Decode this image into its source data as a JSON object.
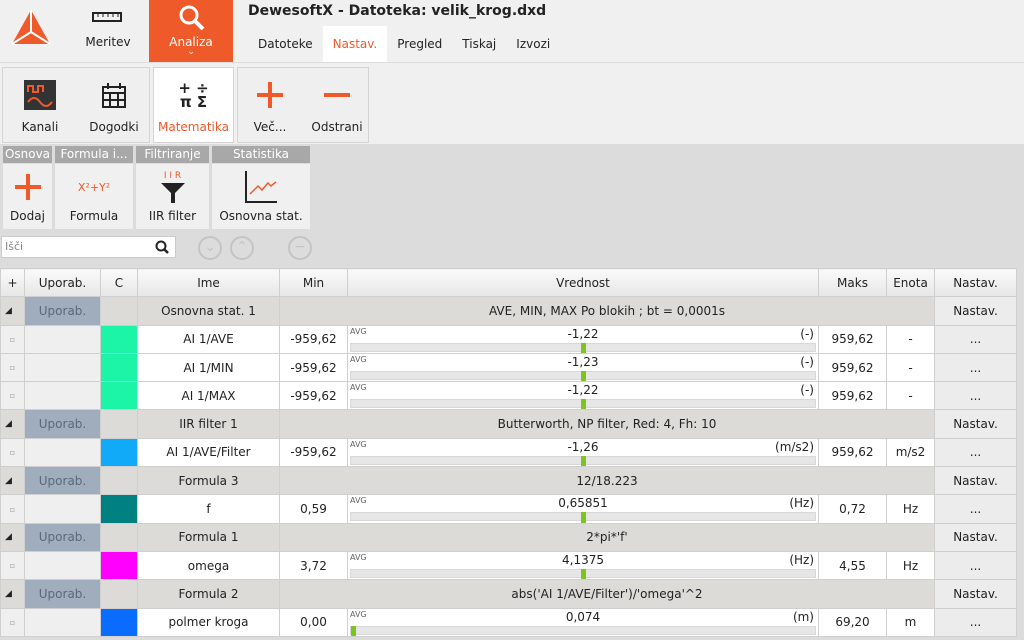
{
  "app": {
    "title": "DewesoftX - Datoteka: velik_krog.dxd",
    "modes": [
      {
        "label": "Meritev",
        "icon": "ruler-icon"
      },
      {
        "label": "Analiza",
        "icon": "search-icon",
        "active": true
      }
    ],
    "menu": [
      "Datoteke",
      "Nastav.",
      "Pregled",
      "Tiskaj",
      "Izvozi"
    ],
    "active_menu": "Nastav."
  },
  "ribbon": [
    {
      "label": "Kanali",
      "icon": "channels-icon"
    },
    {
      "label": "Dogodki",
      "icon": "calendar-icon"
    },
    {
      "label": "Matematika",
      "icon": "math-icon",
      "active": true
    },
    {
      "label": "Več...",
      "icon": "plus-icon"
    },
    {
      "label": "Odstrani",
      "icon": "minus-icon"
    }
  ],
  "math_groups": [
    {
      "header": "Osnova",
      "label": "Dodaj",
      "icon": "plus-icon"
    },
    {
      "header": "Formula i...",
      "label": "Formula",
      "icon": "formula-icon",
      "icon_text": "X²+Y²"
    },
    {
      "header": "Filtriranje",
      "label": "IIR filter",
      "icon": "filter-icon",
      "icon_text": "I I R"
    },
    {
      "header": "Statistika",
      "label": "Osnovna stat.",
      "icon": "stats-icon"
    }
  ],
  "search": {
    "placeholder": "Išči"
  },
  "table": {
    "headers": [
      "+",
      "Uporab.",
      "C",
      "Ime",
      "Min",
      "Vrednost",
      "Maks",
      "Enota",
      "Nastav."
    ],
    "avg_label": "AVG",
    "use_label": "Uporab.",
    "settings_label": "Nastav.",
    "more_label": "...",
    "groups": [
      {
        "name": "Osnovna stat. 1",
        "desc": "AVE, MIN, MAX Po blokih ; bt = 0,0001s",
        "channels": [
          {
            "name": "AI 1/AVE",
            "color": "#1cf5a8",
            "min": "-959,62",
            "value": "-1,22",
            "unit_paren": "(-)",
            "max": "959,62",
            "unit": "-",
            "fraction": 0.499
          },
          {
            "name": "AI 1/MIN",
            "color": "#1cf5a8",
            "min": "-959,62",
            "value": "-1,23",
            "unit_paren": "(-)",
            "max": "959,62",
            "unit": "-",
            "fraction": 0.499
          },
          {
            "name": "AI 1/MAX",
            "color": "#1cf5a8",
            "min": "-959,62",
            "value": "-1,22",
            "unit_paren": "(-)",
            "max": "959,62",
            "unit": "-",
            "fraction": 0.499
          }
        ]
      },
      {
        "name": "IIR filter 1",
        "desc": "Butterworth,  NP filter, Red: 4,  Fh: 10",
        "channels": [
          {
            "name": "AI 1/AVE/Filter",
            "color": "#10aaf8",
            "min": "-959,62",
            "value": "-1,26",
            "unit_paren": "(m/s2)",
            "max": "959,62",
            "unit": "m/s2",
            "fraction": 0.499
          }
        ]
      },
      {
        "name": "Formula 3",
        "desc": "12/18.223",
        "channels": [
          {
            "name": "f",
            "color": "#008080",
            "min": "0,59",
            "value": "0,65851",
            "unit_paren": "(Hz)",
            "max": "0,72",
            "unit": "Hz",
            "fraction": 0.5
          }
        ]
      },
      {
        "name": "Formula 1",
        "desc": "2*pi*'f'",
        "channels": [
          {
            "name": "omega",
            "color": "#ff00ff",
            "min": "3,72",
            "value": "4,1375",
            "unit_paren": "(Hz)",
            "max": "4,55",
            "unit": "Hz",
            "fraction": 0.5
          }
        ]
      },
      {
        "name": "Formula 2",
        "desc": "abs('AI 1/AVE/Filter')/'omega'^2",
        "channels": [
          {
            "name": "polmer kroga",
            "color": "#0a6cff",
            "min": "0,00",
            "value": "0,074",
            "unit_paren": "(m)",
            "max": "69,20",
            "unit": "m",
            "fraction": 0.001
          }
        ]
      }
    ]
  }
}
